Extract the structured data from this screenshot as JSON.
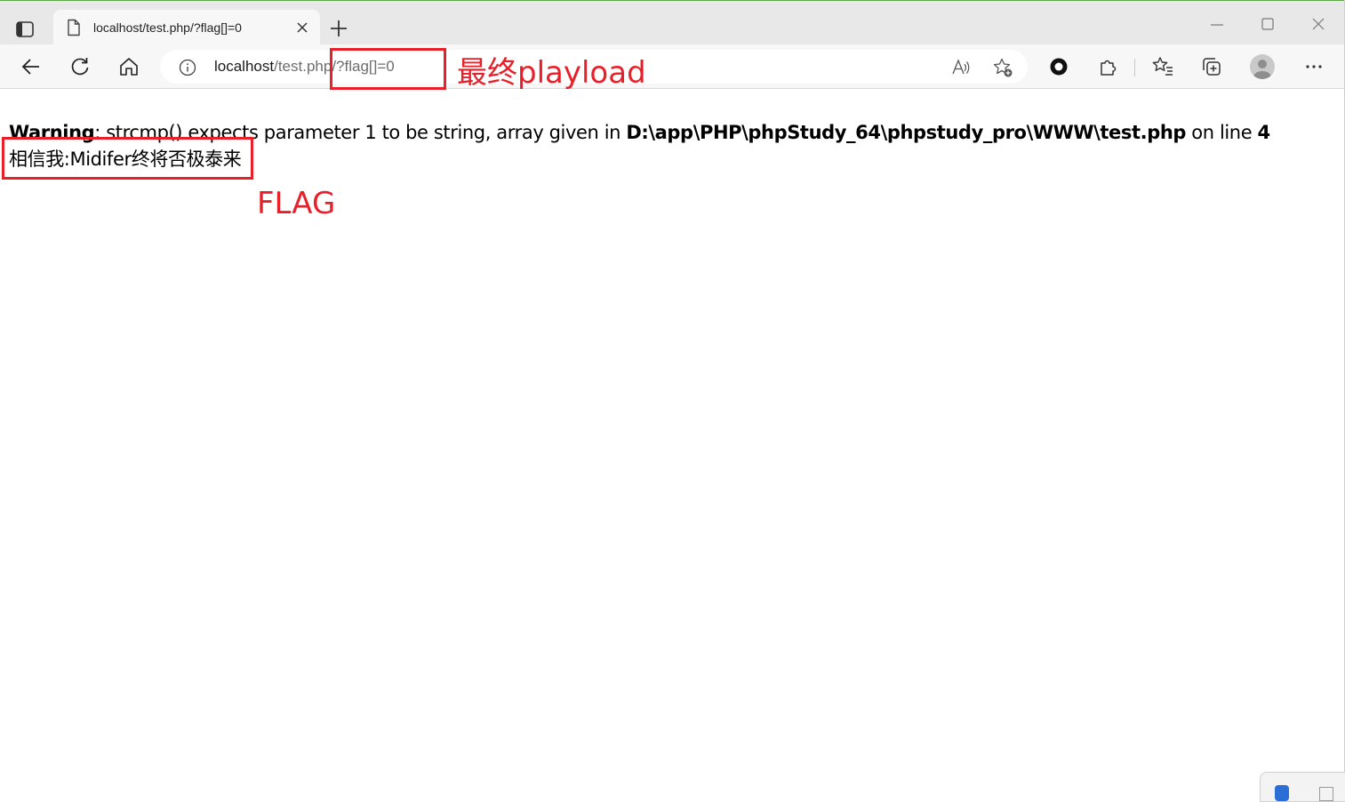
{
  "tab": {
    "title": "localhost/test.php/?flag[]=0"
  },
  "address_bar": {
    "host": "localhost",
    "path": "/test.php/?flag[]=0"
  },
  "page": {
    "warning_label": "Warning",
    "warning_message": ": strcmp() expects parameter 1 to be string, array given in ",
    "file_path": "D:\\app\\PHP\\phpStudy_64\\phpstudy_pro\\WWW\\test.php",
    "on_line_text": " on line ",
    "line_number": "4",
    "flag_text": "相信我:Midifer终将否极泰来"
  },
  "annotations": {
    "payload_label": "最终playload",
    "flag_label": "FLAG",
    "color": "#e8202a"
  },
  "icons": {
    "tab_actions": "tab-actions-icon",
    "page": "page-icon",
    "close": "close-icon",
    "new_tab": "plus-icon",
    "minimize": "minimize-icon",
    "maximize": "maximize-icon",
    "window_close": "close-icon",
    "back": "back-arrow-icon",
    "refresh": "refresh-icon",
    "home": "home-icon",
    "site_info": "info-icon",
    "read_aloud": "read-aloud-icon",
    "add_favorite": "star-plus-icon",
    "extension_circle": "circle-extension-icon",
    "extensions": "puzzle-icon",
    "favorites": "favorites-icon",
    "collections": "collections-icon",
    "profile": "avatar",
    "more": "more-icon"
  }
}
